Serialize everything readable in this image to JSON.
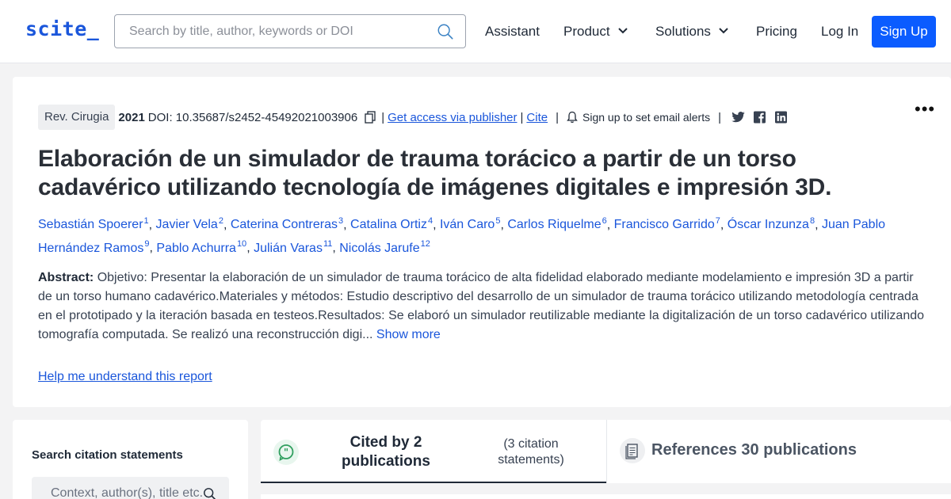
{
  "header": {
    "logo": "scite_",
    "search_placeholder": "Search by title, author, keywords or DOI",
    "nav": [
      "Assistant",
      "Product",
      "Solutions",
      "Pricing",
      "Log In"
    ],
    "signup": "Sign Up"
  },
  "paper": {
    "journal": "Rev. Cirugia",
    "year": "2021",
    "doi": "DOI: 10.35687/s2452-45492021003906",
    "access": "Get access via publisher",
    "cite": "Cite",
    "alert": "Sign up to set email alerts",
    "title": "Elaboración de un simulador de trauma torácico a partir de un torso cadavérico utilizando tecnología de imágenes digitales e impresión 3D.",
    "authors": [
      {
        "name": "Sebastián Spoerer",
        "n": "1"
      },
      {
        "name": "Javier Vela",
        "n": "2"
      },
      {
        "name": "Caterina Contreras",
        "n": "3"
      },
      {
        "name": "Catalina Ortiz",
        "n": "4"
      },
      {
        "name": "Iván Caro",
        "n": "5"
      },
      {
        "name": "Carlos Riquelme",
        "n": "6"
      },
      {
        "name": "Francisco Garrido",
        "n": "7"
      },
      {
        "name": "Óscar Inzunza",
        "n": "8"
      },
      {
        "name": "Juan Pablo Hernández Ramos",
        "n": "9"
      },
      {
        "name": "Pablo Achurra",
        "n": "10"
      },
      {
        "name": "Julián Varas",
        "n": "11"
      },
      {
        "name": "Nicolás Jarufe",
        "n": "12"
      }
    ],
    "abstract_label": "Abstract:",
    "abstract": "Objetivo: Presentar la elaboración de un simulador de trauma torácico de alta fidelidad elaborado mediante modelamiento e impresión 3D a partir de un torso humano cadavérico.Materiales y métodos: Estudio descriptivo del desarrollo de un simulador de trauma torácico utilizando metodología centrada en el prototipado y la iteración basada en testeos.Resultados: Se elaboró un simulador reutilizable mediante la digitalización de un torso cadavérico utilizando tomografía computada. Se realizó una reconstrucción digi...",
    "show_more": "Show more",
    "help": "Help me understand this report"
  },
  "citation_search": {
    "title": "Search citation statements",
    "placeholder": "Context, author(s), title etc."
  },
  "tabs": {
    "cited": "Cited by 2 publications",
    "statements": "(3 citation statements)",
    "references": "References 30 publications"
  },
  "colors": {
    "brand": "#1a56db",
    "signup_bg": "#0b5cff",
    "scite_green": "#2f9e5e"
  }
}
